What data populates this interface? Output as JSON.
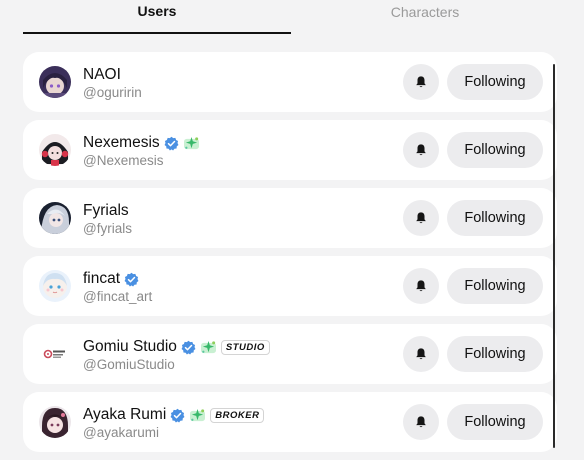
{
  "tabs": [
    {
      "label": "Users",
      "active": true
    },
    {
      "label": "Characters",
      "active": false
    }
  ],
  "users": [
    {
      "name": "NAOI",
      "handle": "@oguririn",
      "verified": false,
      "badge": false,
      "tag": "",
      "avatar": "avatar-dark-purple",
      "follow_label": "Following"
    },
    {
      "name": "Nexemesis",
      "handle": "@Nexemesis",
      "verified": true,
      "badge": true,
      "tag": "",
      "avatar": "avatar-black-red",
      "follow_label": "Following"
    },
    {
      "name": "Fyrials",
      "handle": "@fyrials",
      "verified": false,
      "badge": false,
      "tag": "",
      "avatar": "avatar-silver",
      "follow_label": "Following"
    },
    {
      "name": "fincat",
      "handle": "@fincat_art",
      "verified": true,
      "badge": false,
      "tag": "",
      "avatar": "avatar-pastel",
      "follow_label": "Following"
    },
    {
      "name": "Gomiu Studio",
      "handle": "@GomiuStudio",
      "verified": true,
      "badge": true,
      "tag": "STUDIO",
      "avatar": "avatar-studio-logo",
      "follow_label": "Following"
    },
    {
      "name": "Ayaka Rumi",
      "handle": "@ayakarumi",
      "verified": true,
      "badge": true,
      "tag": "BROKER",
      "avatar": "avatar-pink-hair",
      "follow_label": "Following"
    }
  ],
  "colors": {
    "background": "#f3f3f4",
    "card": "#ffffff",
    "button": "#ececee",
    "verified": "#4a90e2",
    "handle": "#8a8a8a",
    "inactive_tab": "#9a9a9a"
  },
  "icons": {
    "bell": "bell-icon",
    "verified": "verified-check-icon",
    "badge": "sparkle-badge-icon"
  }
}
